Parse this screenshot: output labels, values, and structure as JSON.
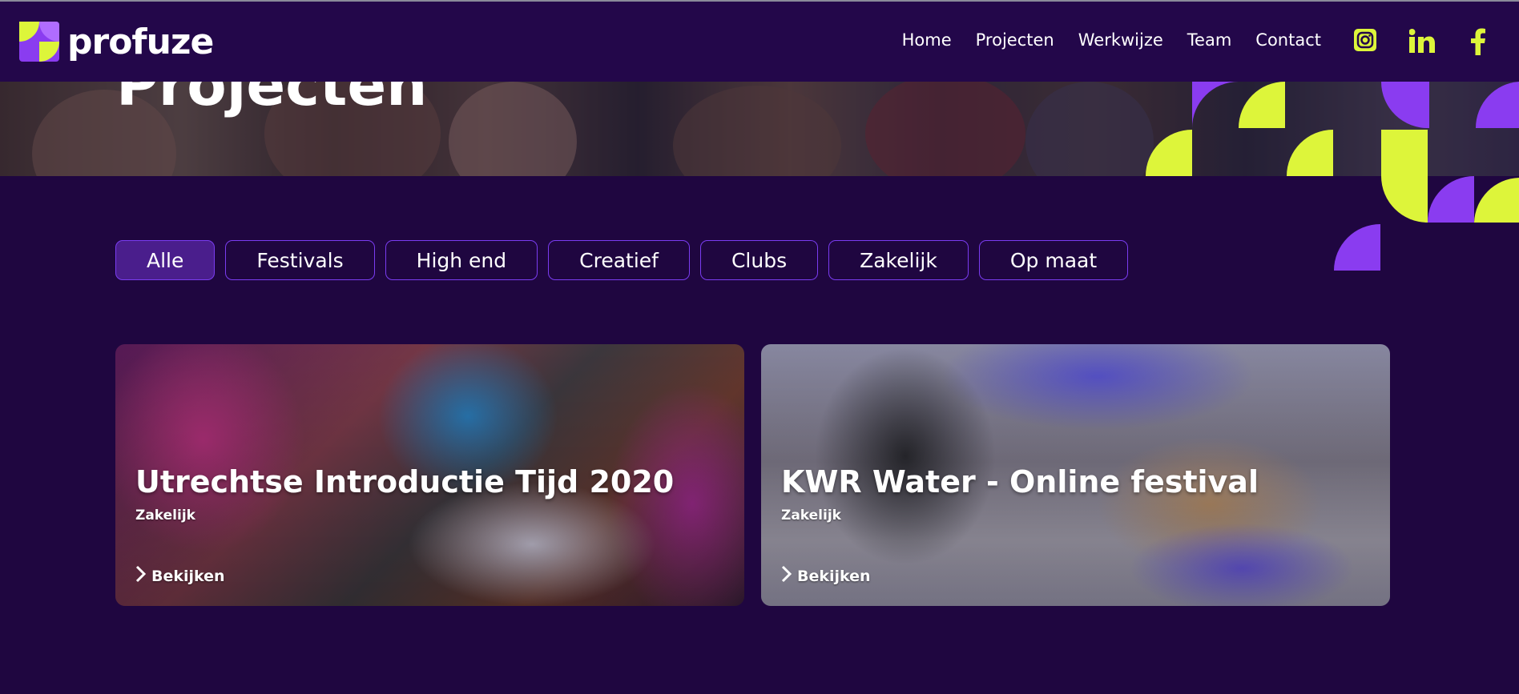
{
  "brand": {
    "name": "profuze",
    "accent_yellow": "#ddf53a",
    "accent_purple": "#8a3cf0",
    "bg": "#1f0640"
  },
  "nav": {
    "items": [
      {
        "label": "Home"
      },
      {
        "label": "Projecten"
      },
      {
        "label": "Werkwijze"
      },
      {
        "label": "Team"
      },
      {
        "label": "Contact"
      }
    ],
    "social": [
      {
        "icon": "instagram-icon"
      },
      {
        "icon": "linkedin-icon"
      },
      {
        "icon": "facebook-icon"
      }
    ]
  },
  "hero": {
    "title": "Projecten"
  },
  "filters": [
    {
      "label": "Alle",
      "active": true
    },
    {
      "label": "Festivals"
    },
    {
      "label": "High end"
    },
    {
      "label": "Creatief"
    },
    {
      "label": "Clubs"
    },
    {
      "label": "Zakelijk"
    },
    {
      "label": "Op maat"
    }
  ],
  "projects": [
    {
      "title": "Utrechtse Introductie Tijd 2020",
      "category": "Zakelijk",
      "link": "Bekijken"
    },
    {
      "title": "KWR Water - Online festival",
      "category": "Zakelijk",
      "link": "Bekijken"
    }
  ]
}
